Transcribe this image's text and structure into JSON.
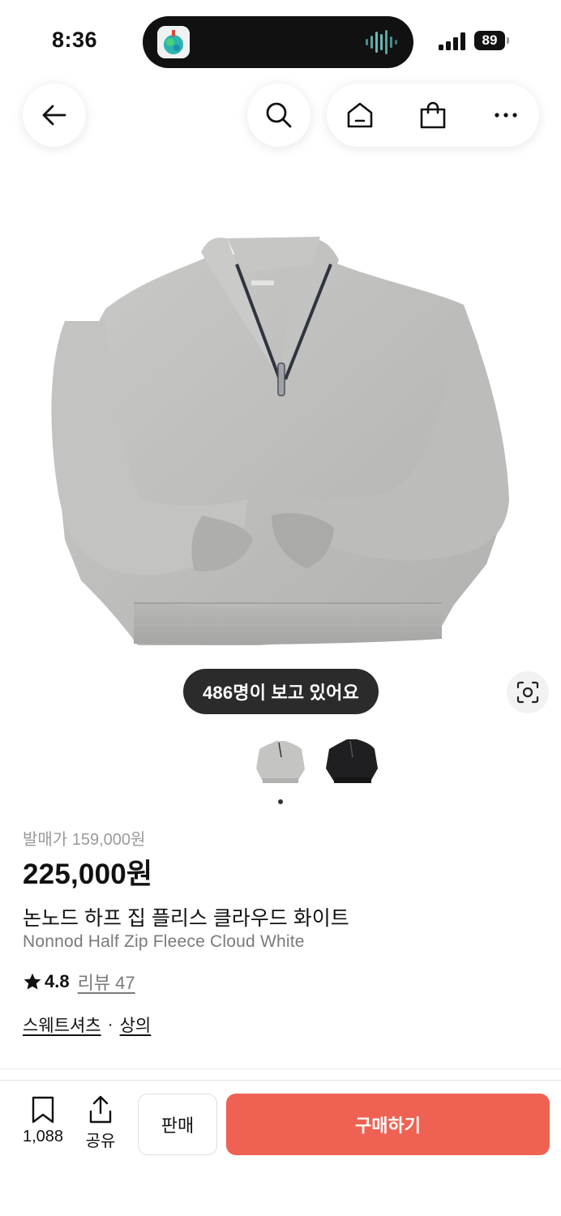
{
  "status_bar": {
    "time": "8:36",
    "battery_level": "89"
  },
  "header": {
    "back_icon": "arrow-left-icon",
    "search_icon": "search-icon",
    "home_icon": "home-icon",
    "bag_icon": "shopping-bag-icon",
    "more_icon": "more-horizontal-icon"
  },
  "gallery": {
    "viewer_badge": "486명이 보고 있어요",
    "lens_icon": "image-search-icon",
    "thumbnails": [
      "grey fleece",
      "black fleece"
    ],
    "active_index": 0
  },
  "product": {
    "release_price": "발매가 159,000원",
    "price": "225,000원",
    "name_ko": "논노드 하프 집 플리스 클라우드 화이트",
    "name_en": "Nonnod Half Zip Fleece Cloud White",
    "rating": "4.8",
    "review_label": "리뷰 47",
    "categories": [
      "스웨트셔츠",
      "상의"
    ],
    "category_separator": "·"
  },
  "bottom_bar": {
    "save_count": "1,088",
    "share_label": "공유",
    "sell_label": "판매",
    "buy_label": "구매하기",
    "buy_color": "#ef6253"
  }
}
